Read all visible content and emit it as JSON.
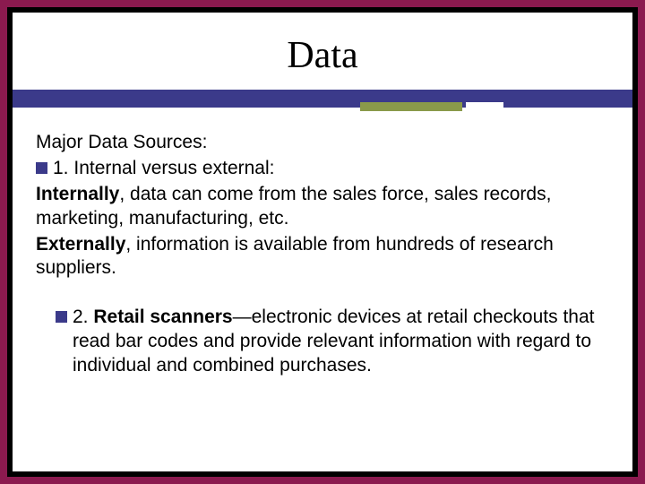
{
  "title": "Data",
  "content": {
    "heading": "Major Data Sources:",
    "item1": {
      "num": "1.",
      "label": "Internal versus external:"
    },
    "internally_b": "Internally",
    "internally_rest": ", data can come from the sales force, sales records, marketing, manufacturing, etc.",
    "externally_b": "Externally",
    "externally_rest": ", information is available from hundreds of research suppliers.",
    "item2": {
      "num": "2.",
      "bold": "Retail scanners",
      "rest": "—electronic devices at retail checkouts that read bar codes and provide relevant information with regard to individual and combined purchases."
    }
  }
}
